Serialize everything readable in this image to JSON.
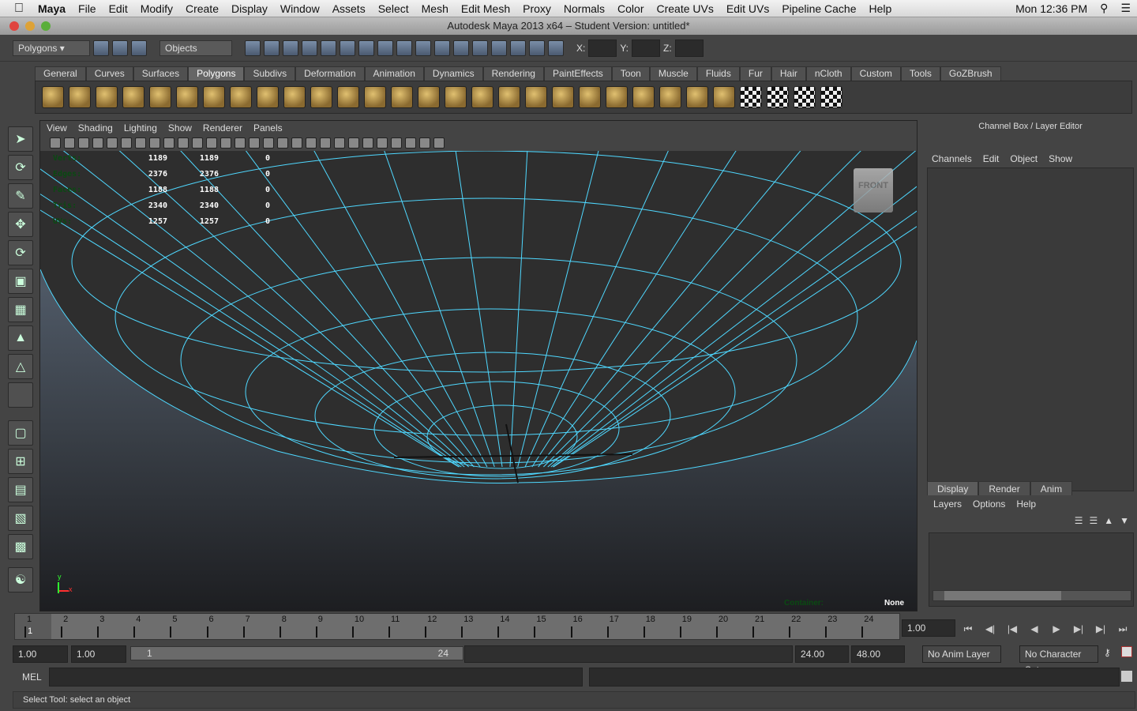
{
  "menubar": {
    "app": "Maya",
    "items": [
      "File",
      "Edit",
      "Modify",
      "Create",
      "Display",
      "Window",
      "Assets",
      "Select",
      "Mesh",
      "Edit Mesh",
      "Proxy",
      "Normals",
      "Color",
      "Create UVs",
      "Edit UVs",
      "Pipeline Cache",
      "Help"
    ],
    "clock": "Mon 12:36 PM"
  },
  "window": {
    "title": "Autodesk Maya 2013 x64 – Student Version: untitled*"
  },
  "status": {
    "menu_set": "Polygons",
    "selection_mode": "Objects",
    "x_label": "X:",
    "y_label": "Y:",
    "z_label": "Z:"
  },
  "shelf": {
    "tabs": [
      "General",
      "Curves",
      "Surfaces",
      "Polygons",
      "Subdivs",
      "Deformation",
      "Animation",
      "Dynamics",
      "Rendering",
      "PaintEffects",
      "Toon",
      "Muscle",
      "Fluids",
      "Fur",
      "Hair",
      "nCloth",
      "Custom",
      "Tools",
      "GoZBrush"
    ],
    "active_tab": "Polygons",
    "icon_count": 30
  },
  "viewport": {
    "menu": [
      "View",
      "Shading",
      "Lighting",
      "Show",
      "Renderer",
      "Panels"
    ],
    "hud": [
      {
        "label": "Verts:",
        "a": "1189",
        "b": "1189",
        "c": "0"
      },
      {
        "label": "Edges:",
        "a": "2376",
        "b": "2376",
        "c": "0"
      },
      {
        "label": "Faces:",
        "a": "1188",
        "b": "1188",
        "c": "0"
      },
      {
        "label": "Tris:",
        "a": "2340",
        "b": "2340",
        "c": "0"
      },
      {
        "label": "UVs:",
        "a": "1257",
        "b": "1257",
        "c": "0"
      }
    ],
    "view_cube": "FRONT",
    "container_label": "Container:",
    "container_value": "None",
    "axis_y": "y",
    "axis_x": "x",
    "wire_color": "#4fd8ff"
  },
  "channel_box": {
    "title": "Channel Box / Layer Editor",
    "menu": [
      "Channels",
      "Edit",
      "Object",
      "Show"
    ]
  },
  "layer_editor": {
    "tabs": [
      "Display",
      "Render",
      "Anim"
    ],
    "active_tab": "Display",
    "menu": [
      "Layers",
      "Options",
      "Help"
    ]
  },
  "timeline": {
    "frames": [
      "1",
      "2",
      "3",
      "4",
      "5",
      "6",
      "7",
      "8",
      "9",
      "10",
      "11",
      "12",
      "13",
      "14",
      "15",
      "16",
      "17",
      "18",
      "19",
      "20",
      "21",
      "22",
      "23",
      "24"
    ],
    "current_frame_marker": "1",
    "current_time": "1.00"
  },
  "range": {
    "start_time": "1.00",
    "playback_start": "1.00",
    "range_start": "1",
    "range_end": "24",
    "playback_end": "24.00",
    "end_time": "48.00",
    "anim_layer": "No Anim Layer",
    "character_set": "No Character Set"
  },
  "command": {
    "label": "MEL"
  },
  "help_line": "Select Tool: select an object"
}
